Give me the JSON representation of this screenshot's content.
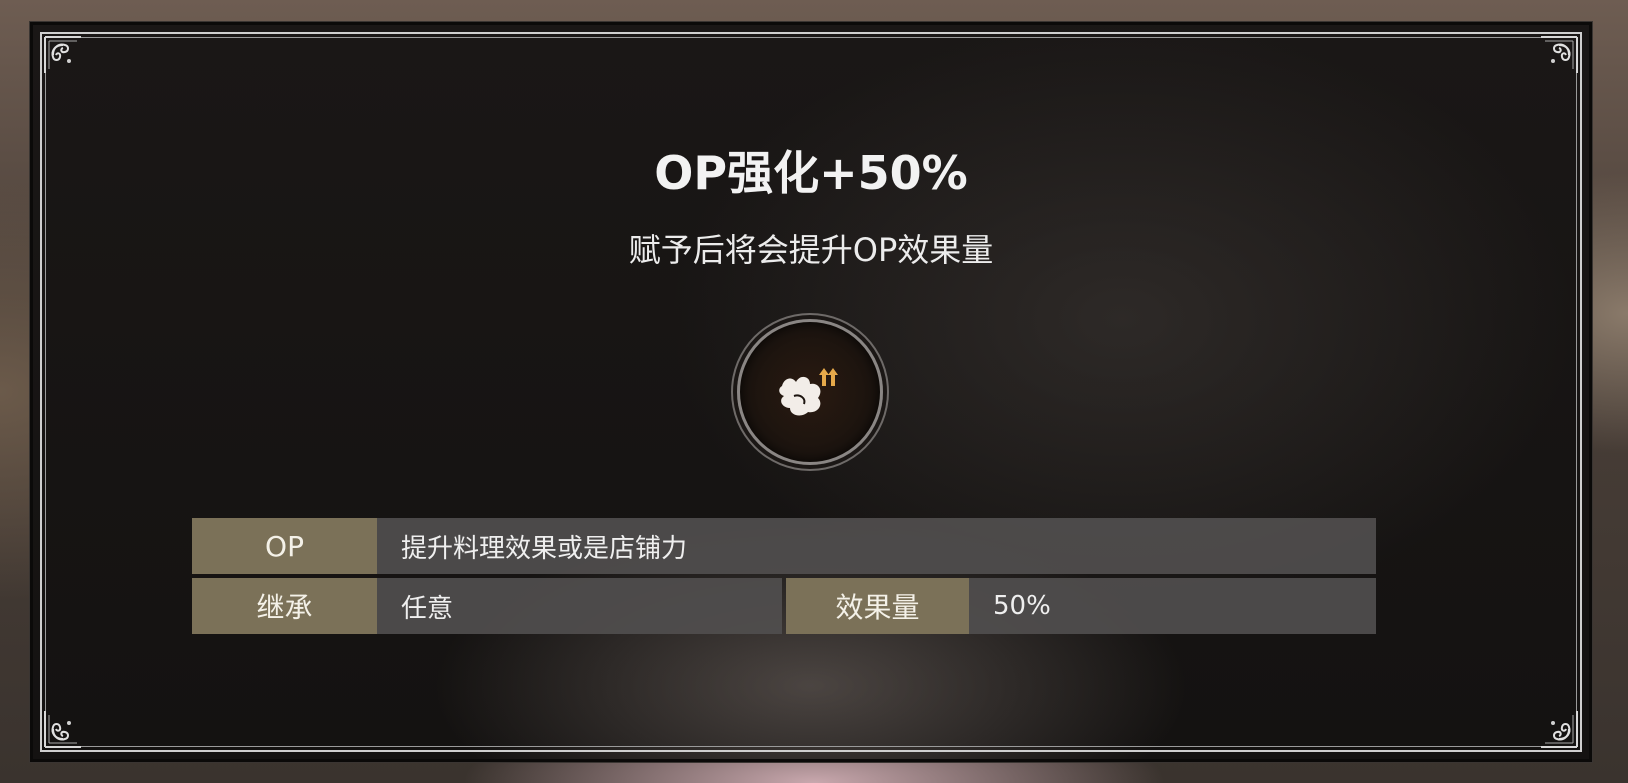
{
  "skill": {
    "title": "OP强化+50%",
    "description": "赋予后将会提升OP效果量",
    "icon": "wing-up-arrows-icon"
  },
  "details": {
    "op_label": "OP",
    "op_value": "提升料理效果或是店铺力",
    "inherit_label": "继承",
    "inherit_value": "任意",
    "effect_label": "效果量",
    "effect_value": "50%"
  },
  "colors": {
    "label_bg": "#7b7158",
    "value_bg": "#504e4e",
    "arrow_accent": "#e6a94a"
  }
}
